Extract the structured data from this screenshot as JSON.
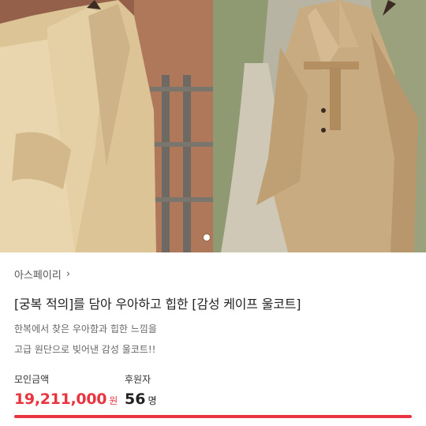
{
  "hero": {
    "images": [
      {
        "alt": "camel wool cape coat front view"
      },
      {
        "alt": "camel wool cape coat with belt outdoors"
      }
    ]
  },
  "product": {
    "brand": "아스페이리",
    "title": "[궁복 적의]를 담아 우아하고 힙한 [감성 케이프 울코트]",
    "description_line1": "한복에서 찾은 우아함과 힙한 느낌을",
    "description_line2": "고급 원단으로 빚어낸 감성 울코트!!"
  },
  "stats": {
    "amount_label": "모인금액",
    "amount_value": "19,211,000",
    "amount_unit": "원",
    "backers_label": "후원자",
    "backers_value": "56",
    "backers_unit": "명"
  },
  "colors": {
    "accent": "#e8353f",
    "coat": "#d7bd8f"
  },
  "progress": 1.0
}
